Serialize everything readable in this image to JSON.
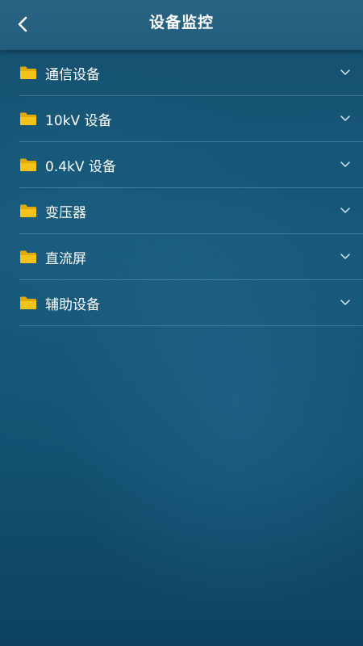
{
  "header": {
    "title": "设备监控",
    "back_icon": "chevron-left-icon"
  },
  "colors": {
    "folder": "#f4c31a",
    "folder_tab": "#e0a908",
    "text": "#ffffff",
    "divider": "#8fb8cf"
  },
  "categories": [
    {
      "label": "通信设备",
      "icon": "folder-icon",
      "expand_icon": "chevron-down-icon"
    },
    {
      "label": "10kV 设备",
      "icon": "folder-icon",
      "expand_icon": "chevron-down-icon"
    },
    {
      "label": "0.4kV 设备",
      "icon": "folder-icon",
      "expand_icon": "chevron-down-icon"
    },
    {
      "label": "变压器",
      "icon": "folder-icon",
      "expand_icon": "chevron-down-icon"
    },
    {
      "label": "直流屏",
      "icon": "folder-icon",
      "expand_icon": "chevron-down-icon"
    },
    {
      "label": "辅助设备",
      "icon": "folder-icon",
      "expand_icon": "chevron-down-icon"
    }
  ]
}
